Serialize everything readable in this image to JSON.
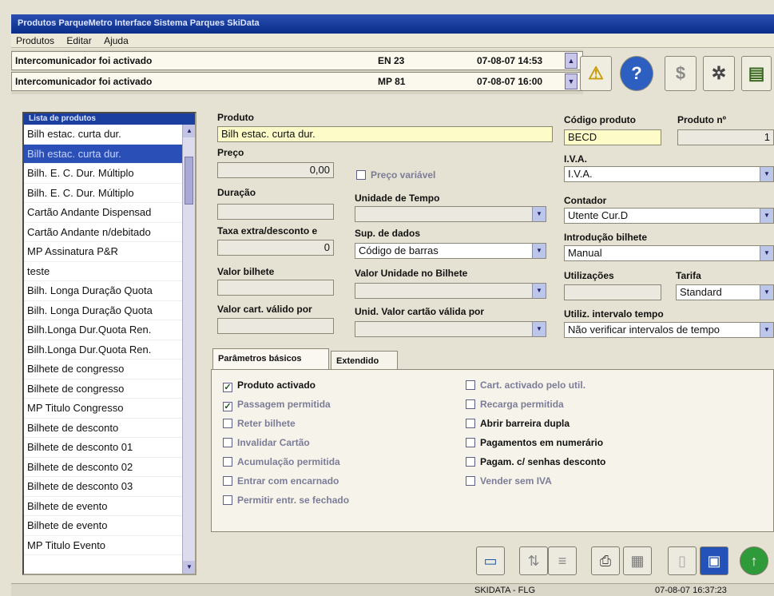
{
  "window": {
    "title": "Produtos   ParqueMetro Interface   Sistema Parques SkiData"
  },
  "menu": {
    "items": [
      "Produtos",
      "Editar",
      "Ajuda"
    ]
  },
  "alarms": [
    {
      "message": "Intercomunicador foi activado",
      "device": "EN 23",
      "datetime": "07-08-07 14:53"
    },
    {
      "message": "Intercomunicador foi activado",
      "device": "MP 81",
      "datetime": "07-08-07 16:00"
    }
  ],
  "toolbar_icons": [
    "warning-icon",
    "help-icon",
    "money-bag-icon",
    "settings-wheel-icon",
    "report-icon"
  ],
  "product_list": {
    "header": "Lista de produtos",
    "selected_index": 1,
    "items": [
      "Bilh estac. curta dur.",
      "Bilh estac. curta dur.",
      "Bilh. E. C. Dur. Múltiplo",
      "Bilh. E. C. Dur. Múltiplo",
      "Cartão Andante Dispensad",
      "Cartão Andante n/debitado",
      "MP Assinatura P&R",
      "teste",
      "Bilh. Longa Duração Quota",
      "Bilh. Longa Duração Quota",
      "Bilh.Longa Dur.Quota Ren.",
      "Bilh.Longa Dur.Quota Ren.",
      "Bilhete de congresso",
      "Bilhete de congresso",
      "MP Titulo Congresso",
      "Bilhete de desconto",
      "Bilhete de desconto 01",
      "Bilhete de desconto 02",
      "Bilhete de desconto 03",
      "Bilhete de evento",
      "Bilhete de evento",
      "MP Titulo Evento"
    ]
  },
  "form": {
    "produto": {
      "label": "Produto",
      "value": "Bilh estac. curta dur."
    },
    "preco": {
      "label": "Preço",
      "value": "0,00"
    },
    "preco_variavel": {
      "label": "Preço variável",
      "checked": false
    },
    "duracao": {
      "label": "Duração",
      "value": ""
    },
    "unidade_tempo": {
      "label": "Unidade de Tempo",
      "value": ""
    },
    "taxa_extra": {
      "label": "Taxa extra/desconto e",
      "value": "0"
    },
    "sup_dados": {
      "label": "Sup. de dados",
      "value": "Código de barras"
    },
    "valor_bilhete": {
      "label": "Valor bilhete",
      "value": ""
    },
    "valor_unidade": {
      "label": "Valor Unidade no Bilhete",
      "value": ""
    },
    "valor_cartao": {
      "label": "Valor cart. válido por",
      "value": ""
    },
    "unid_valor_cartao": {
      "label": "Unid. Valor cartão válida por",
      "value": ""
    },
    "codigo_produto": {
      "label": "Código produto",
      "value": "BECD"
    },
    "produto_numero": {
      "label": "Produto nº",
      "value": "1"
    },
    "iva": {
      "label": "I.V.A.",
      "value": "I.V.A."
    },
    "contador": {
      "label": "Contador",
      "value": "Utente Cur.D"
    },
    "introducao_bilhete": {
      "label": "Introdução bilhete",
      "value": "Manual"
    },
    "utilizacoes": {
      "label": "Utilizações",
      "value": ""
    },
    "tarifa": {
      "label": "Tarifa",
      "value": "Standard"
    },
    "utiliz_intervalo": {
      "label": "Utiliz. intervalo tempo",
      "value": "Não verificar intervalos de tempo"
    }
  },
  "tabs": [
    {
      "label": "Parâmetros básicos",
      "active": true
    },
    {
      "label": "Extendido",
      "active": false
    }
  ],
  "params_left": [
    {
      "label": "Produto activado",
      "checked": true,
      "style": "strong"
    },
    {
      "label": "Passagem permitida",
      "checked": true,
      "style": "dim"
    },
    {
      "label": "Reter bilhete",
      "checked": false,
      "style": "dim"
    },
    {
      "label": "Invalidar Cartão",
      "checked": false,
      "style": "dim"
    },
    {
      "label": "Acumulação permitida",
      "checked": false,
      "style": "dim"
    },
    {
      "label": "Entrar com encarnado",
      "checked": false,
      "style": "dim"
    },
    {
      "label": "Permitir entr. se fechado",
      "checked": false,
      "style": "dim"
    }
  ],
  "params_right": [
    {
      "label": "Cart. activado pelo util.",
      "checked": false,
      "style": "dim"
    },
    {
      "label": "Recarga permitida",
      "checked": false,
      "style": "dim"
    },
    {
      "label": "Abrir barreira dupla",
      "checked": false,
      "style": "strong"
    },
    {
      "label": "Pagamentos em numerário",
      "checked": false,
      "style": "strong"
    },
    {
      "label": "Pagam. c/ senhas desconto",
      "checked": false,
      "style": "strong"
    },
    {
      "label": "Vender sem IVA",
      "checked": false,
      "style": "dim"
    }
  ],
  "bottom_buttons": [
    "card-icon",
    "sort-icon",
    "list-icon",
    "print-icon",
    "calendar-icon",
    "new-document-icon",
    "save-icon",
    "up-arrow-icon"
  ],
  "status": {
    "system": "SKIDATA - FLG",
    "datetime": "07-08-07 16:37:23"
  },
  "colors": {
    "title_bar": "#0a2d8a",
    "selection": "#2a50b8",
    "highlight_field": "#fdfcc8",
    "background": "#e6e2d3"
  }
}
